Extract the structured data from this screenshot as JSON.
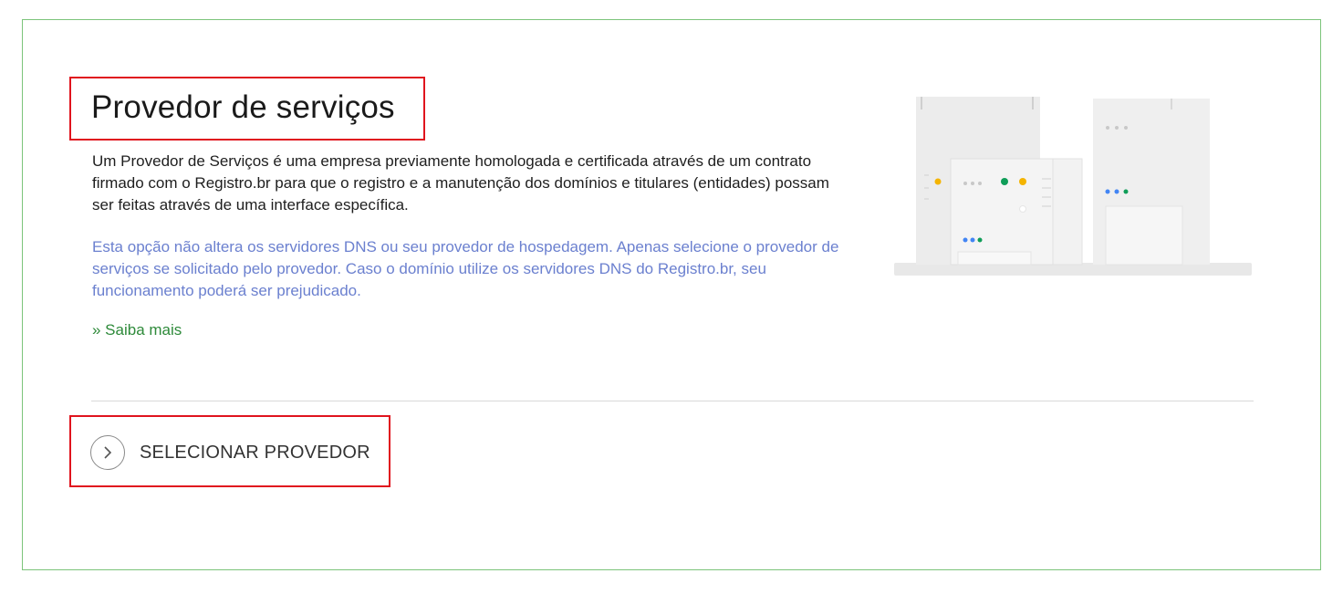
{
  "section": {
    "title": "Provedor de serviços",
    "description": "Um Provedor de Serviços é uma empresa previamente homologada e certificada através de um contrato firmado com o Registro.br para que o registro e a manutenção dos domínios e titulares (entidades) possam ser feitas através de uma interface específica.",
    "notice": "Esta opção não altera os servidores DNS ou seu provedor de hospedagem. Apenas selecione o provedor de serviços se solicitado pelo provedor. Caso o domínio utilize os servidores DNS do Registro.br, seu funcionamento poderá ser prejudicado.",
    "learn_more": "» Saiba mais"
  },
  "action": {
    "select_label": "SELECIONAR PROVEDOR",
    "icon": "chevron-right-icon"
  },
  "illustration": {
    "icon": "servers-illustration"
  },
  "colors": {
    "card_border": "#7cc47a",
    "highlight_border": "#e0141e",
    "notice_text": "#6b80cf",
    "link_text": "#2e8a3a"
  }
}
